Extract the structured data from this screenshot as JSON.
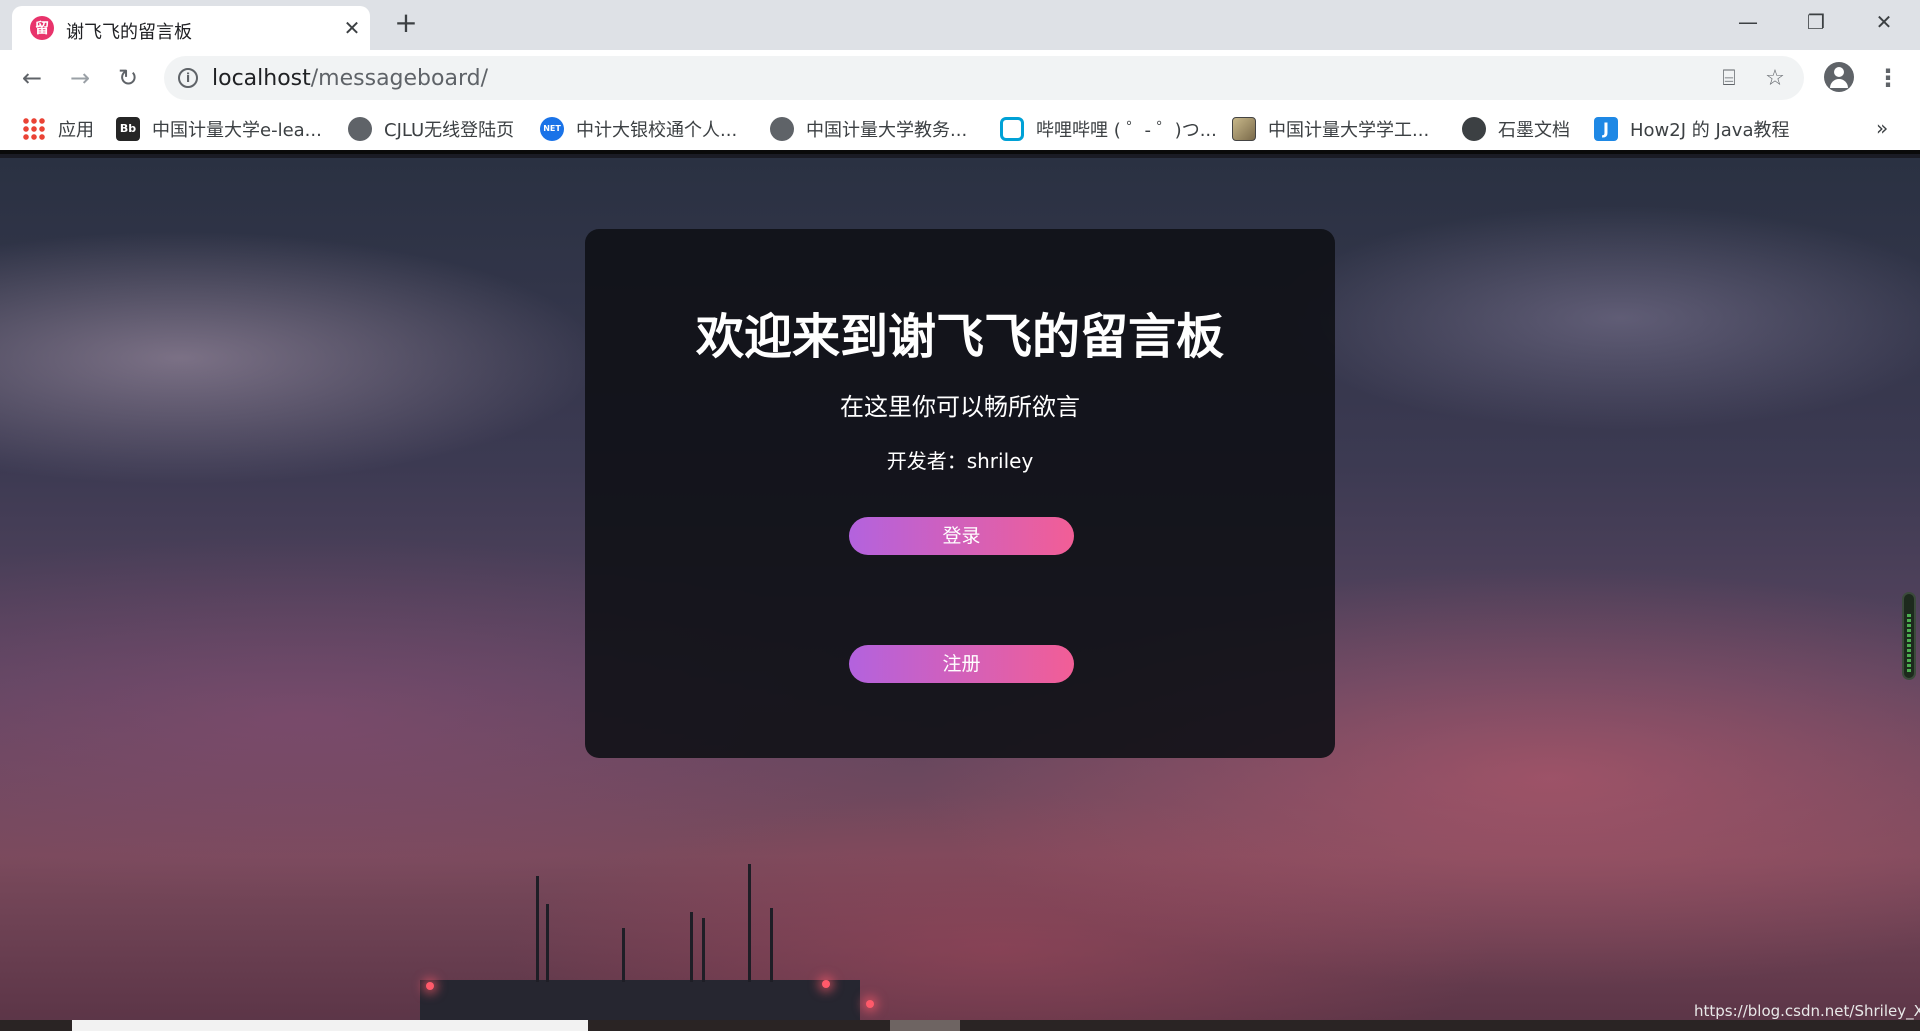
{
  "browser": {
    "tab": {
      "favicon_glyph": "留",
      "title": "谢飞飞的留言板",
      "close_glyph": "✕"
    },
    "new_tab_glyph": "+",
    "window_controls": {
      "minimize_glyph": "—",
      "restore_glyph": "❐",
      "close_glyph": "✕"
    },
    "nav": {
      "back_glyph": "←",
      "forward_glyph": "→",
      "reload_glyph": "↻"
    },
    "address": {
      "host": "localhost",
      "path": "/messageboard/",
      "info_glyph": "i",
      "translate_glyph": "⌸",
      "bookmark_glyph": "☆"
    },
    "menu_glyph": "⋮"
  },
  "bookmarks": {
    "items": [
      {
        "label": "应用",
        "icon": "apps-grid-icon"
      },
      {
        "label": "中国计量大学e-lea...",
        "icon": "blackboard-icon",
        "icon_text": "Bb"
      },
      {
        "label": "CJLU无线登陆页",
        "icon": "globe-icon"
      },
      {
        "label": "中计大银校通个人...",
        "icon": "bank-icon",
        "icon_text": "NET"
      },
      {
        "label": "中国计量大学教务...",
        "icon": "globe-icon"
      },
      {
        "label": "哔哩哔哩 ( ゜- ゜)つ...",
        "icon": "bilibili-icon"
      },
      {
        "label": "中国计量大学学工...",
        "icon": "image-icon"
      },
      {
        "label": "石墨文档",
        "icon": "shimo-icon"
      },
      {
        "label": "How2J 的 Java教程",
        "icon": "how2j-icon",
        "icon_text": "J"
      }
    ],
    "overflow_glyph": "»"
  },
  "card": {
    "title": "欢迎来到谢飞飞的留言板",
    "subtitle": "在这里你可以畅所欲言",
    "developer": "开发者：shriley",
    "login_label": "登录",
    "register_label": "注册"
  },
  "watermark": "https://blog.csdn.net/Shriley_X",
  "colors": {
    "button_gradient_start": "#b362de",
    "button_gradient_end": "#f25e96",
    "card_background": "#101116",
    "tab_favicon": "#e8336b"
  }
}
